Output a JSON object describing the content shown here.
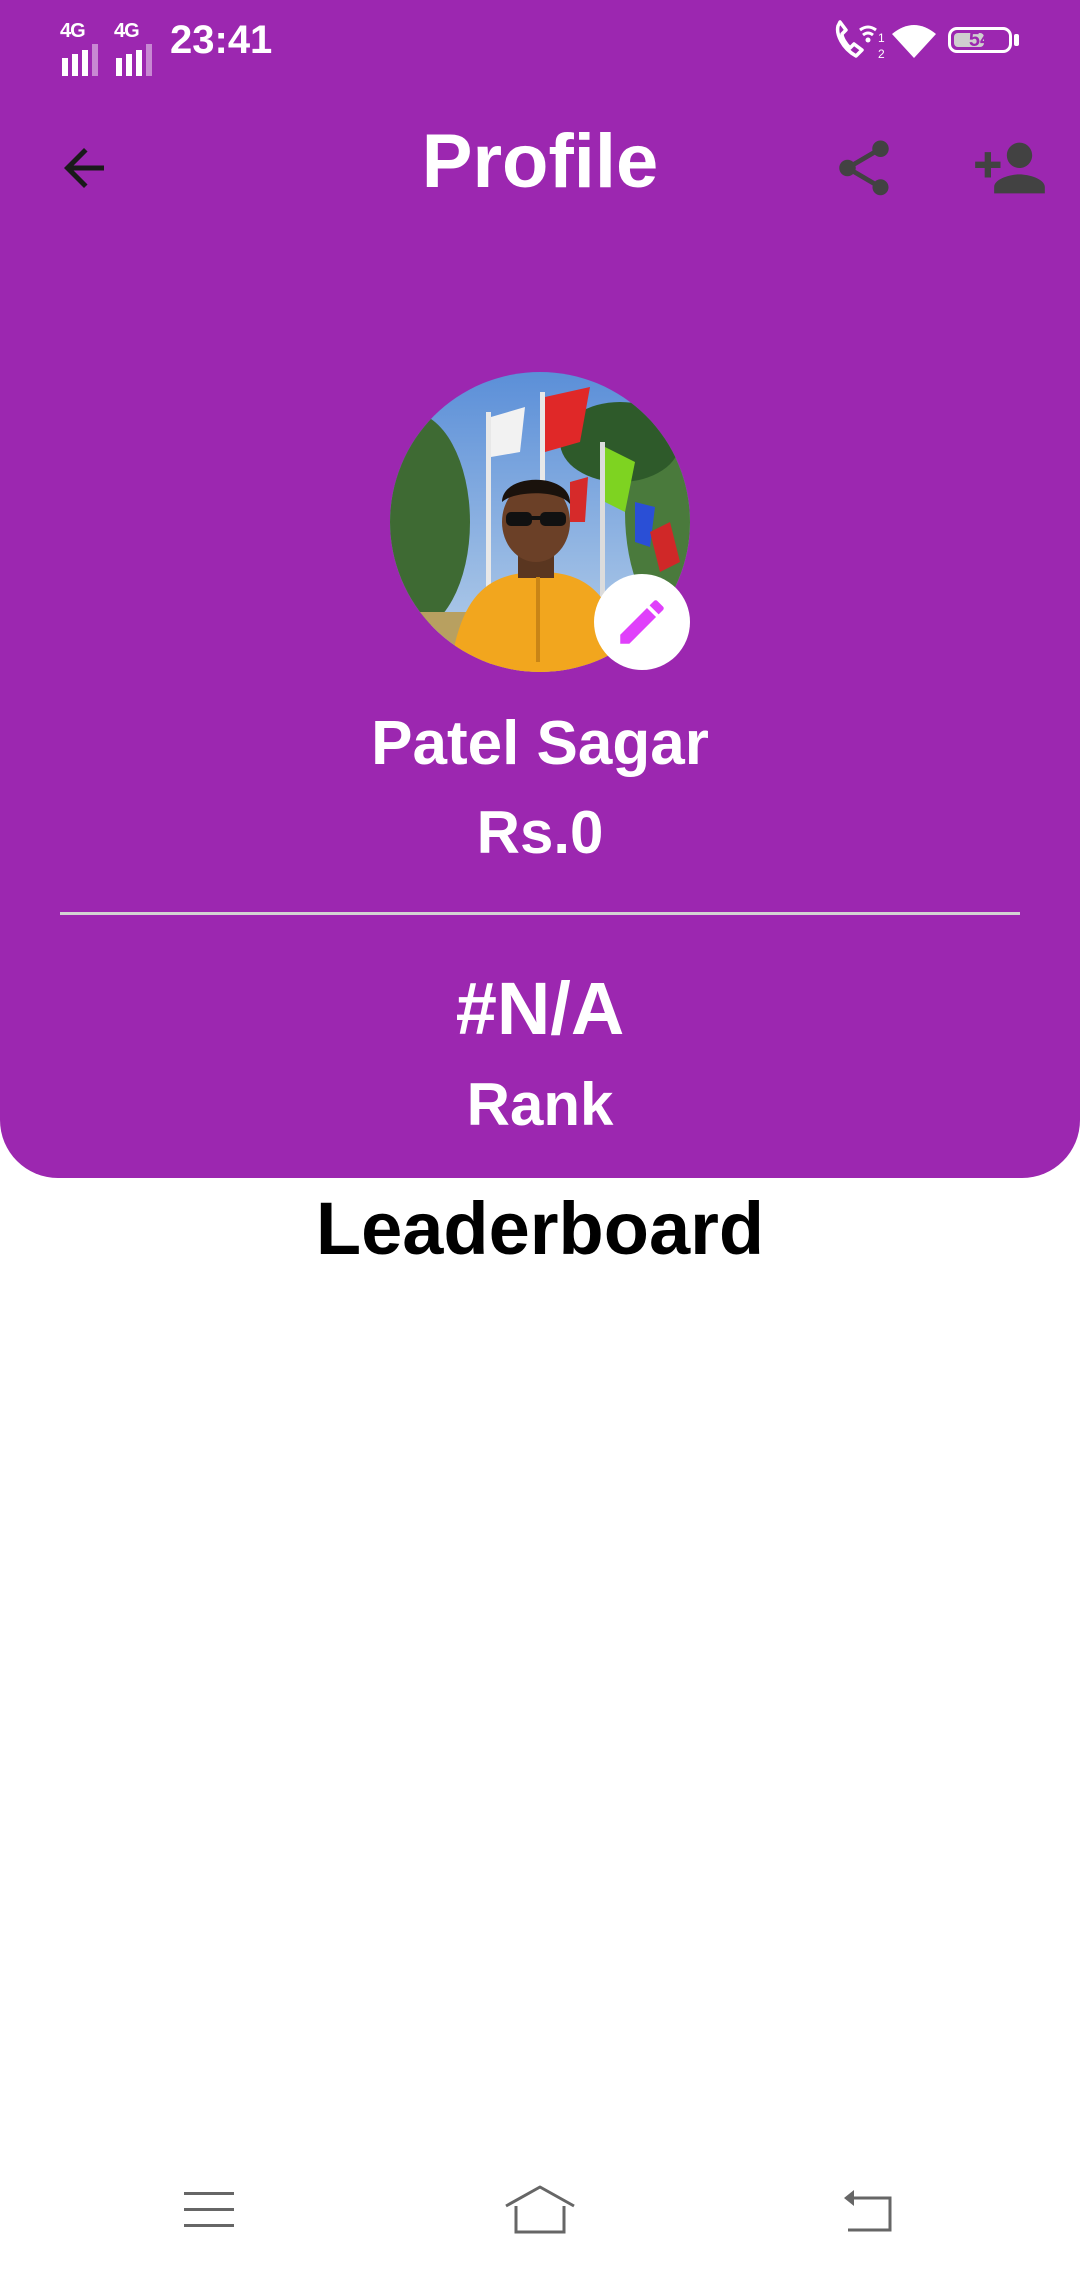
{
  "status_bar": {
    "network_1": "4G",
    "network_2": "4G",
    "time": "23:41",
    "battery_level": "54"
  },
  "app_bar": {
    "title": "Profile",
    "icons": [
      "back-arrow-icon",
      "share-icon",
      "add-person-icon"
    ]
  },
  "profile": {
    "name": "Patel Sagar",
    "balance": "Rs.0",
    "rank_value": "#N/A",
    "rank_label": "Rank"
  },
  "section": {
    "title": "Leaderboard"
  },
  "colors": {
    "header_bg": "#9c27b0",
    "edit_icon": "#e040fb",
    "page_bg": "#ffffff"
  },
  "nav_bar": {
    "icons": [
      "menu-icon",
      "home-icon",
      "back-icon"
    ]
  }
}
